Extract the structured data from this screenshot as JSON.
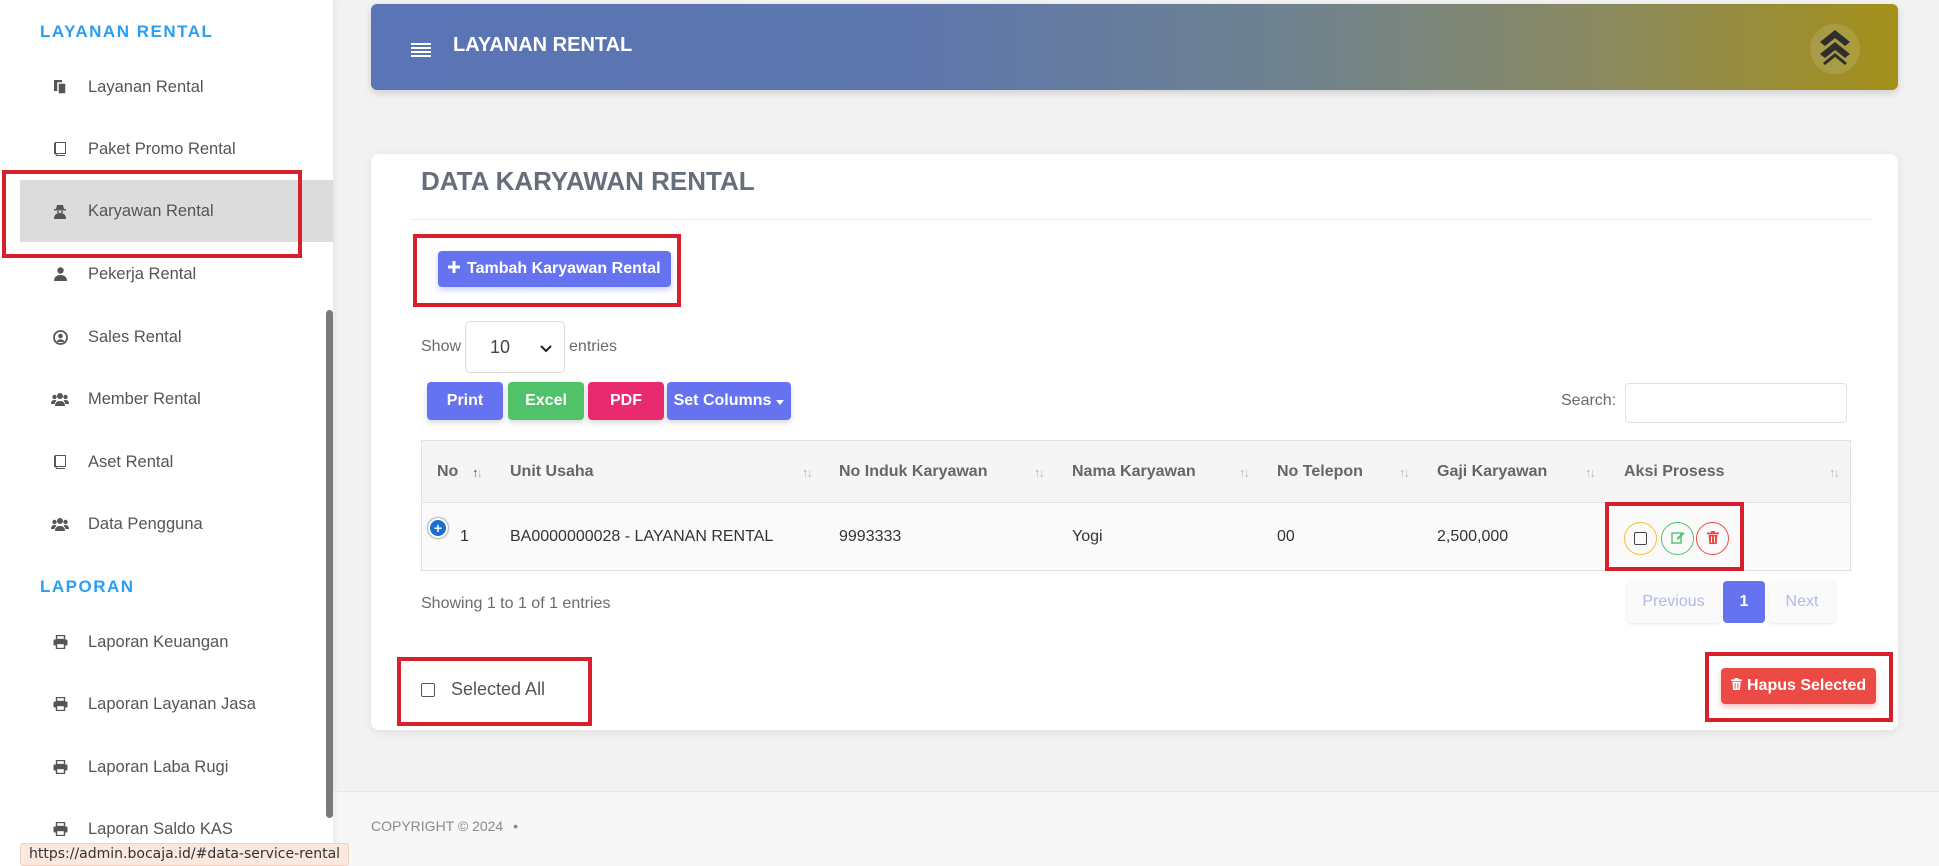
{
  "sidebar": {
    "section_layanan": "LAYANAN RENTAL",
    "section_laporan": "LAPORAN",
    "items": [
      {
        "label": "Layanan Rental",
        "icon": "copy-icon"
      },
      {
        "label": "Paket Promo Rental",
        "icon": "book-icon"
      },
      {
        "label": "Karyawan Rental",
        "icon": "user-secret-icon"
      },
      {
        "label": "Pekerja Rental",
        "icon": "user-icon"
      },
      {
        "label": "Sales Rental",
        "icon": "user-circle-icon"
      },
      {
        "label": "Member Rental",
        "icon": "users-icon"
      },
      {
        "label": "Aset Rental",
        "icon": "book-icon"
      },
      {
        "label": "Data Pengguna",
        "icon": "users-icon"
      }
    ],
    "report_items": [
      {
        "label": "Laporan Keuangan",
        "icon": "print-icon"
      },
      {
        "label": "Laporan Layanan Jasa",
        "icon": "print-icon"
      },
      {
        "label": "Laporan Laba Rugi",
        "icon": "print-icon"
      },
      {
        "label": "Laporan Saldo KAS",
        "icon": "print-icon"
      }
    ]
  },
  "status_url": "https://admin.bocaja.id/#data-service-rental",
  "header": {
    "title": "LAYANAN RENTAL"
  },
  "card": {
    "title": "DATA KARYAWAN RENTAL",
    "add_button": "Tambah Karyawan Rental",
    "show_label": "Show",
    "entries_label": "entries",
    "page_size": "10",
    "export": {
      "print": "Print",
      "excel": "Excel",
      "pdf": "PDF",
      "columns": "Set Columns"
    },
    "search_label": "Search:",
    "columns": [
      "No",
      "Unit Usaha",
      "No Induk Karyawan",
      "Nama Karyawan",
      "No Telepon",
      "Gaji Karyawan",
      "Aksi Prosess"
    ],
    "rows": [
      {
        "no": "1",
        "unit": "BA0000000028 - LAYANAN RENTAL",
        "nik": "9993333",
        "nama": "Yogi",
        "telp": "00",
        "gaji": "2,500,000"
      }
    ],
    "showing": "Showing 1 to 1 of 1 entries",
    "pagination": {
      "previous": "Previous",
      "current": "1",
      "next": "Next"
    },
    "selected_all": "Selected All",
    "delete_selected": "Hapus Selected"
  },
  "footer": {
    "copyright": "COPYRIGHT © 2024"
  },
  "colors": {
    "accent": "#6673f0",
    "section": "#2a9df4",
    "danger": "#ec4a45",
    "success": "#4fc26a",
    "pink": "#ea2a6e",
    "highlight": "#d81f2c"
  }
}
